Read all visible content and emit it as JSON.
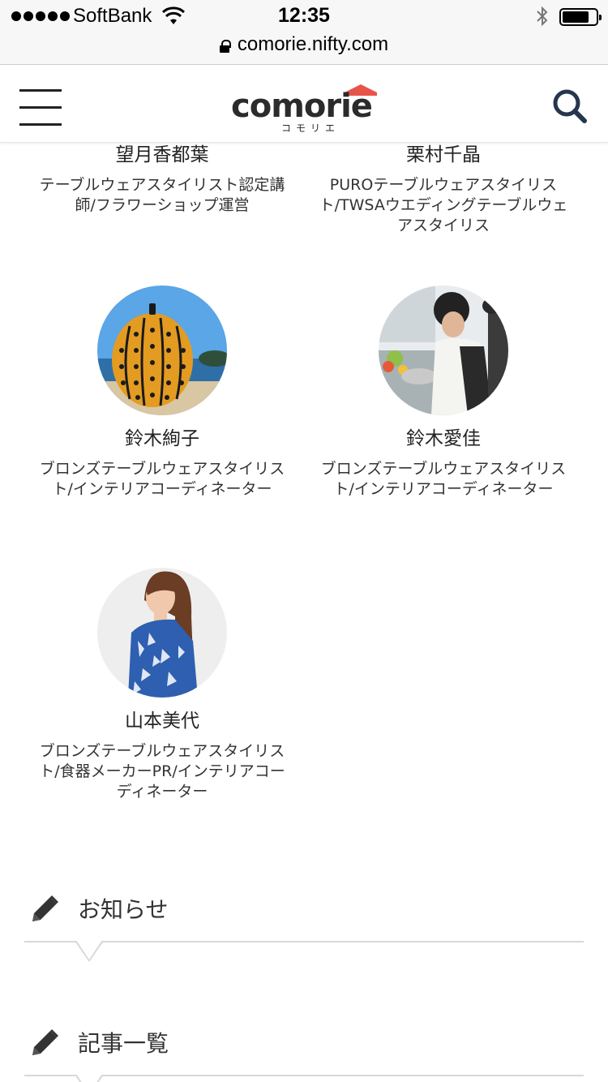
{
  "status_bar": {
    "carrier": "SoftBank",
    "time": "12:35"
  },
  "browser": {
    "url": "comorie.nifty.com"
  },
  "header": {
    "logo_text": "comorie",
    "logo_sub": "コモリエ",
    "brand_color": "#e8544a",
    "icons": [
      "hamburger-menu-icon",
      "search-icon"
    ]
  },
  "profiles": [
    {
      "name": "望月香都葉",
      "role": "テーブルウェアスタイリスト認定講師/フラワーショップ運営"
    },
    {
      "name": "栗村千晶",
      "role": "PUROテーブルウェアスタイリスト/TWSAウエディングテーブルウェアスタイリス"
    },
    {
      "name": "鈴木絢子",
      "role": "ブロンズテーブルウェアスタイリスト/インテリアコーディネーター"
    },
    {
      "name": "鈴木愛佳",
      "role": "ブロンズテーブルウェアスタイリスト/インテリアコーディネーター"
    },
    {
      "name": "山本美代",
      "role": "ブロンズテーブルウェアスタイリスト/食器メーカーPR/インテリアコーディネーター"
    }
  ],
  "sections": [
    {
      "title": "お知らせ",
      "icon": "pencil-icon"
    },
    {
      "title": "記事一覧",
      "icon": "pencil-icon"
    }
  ]
}
